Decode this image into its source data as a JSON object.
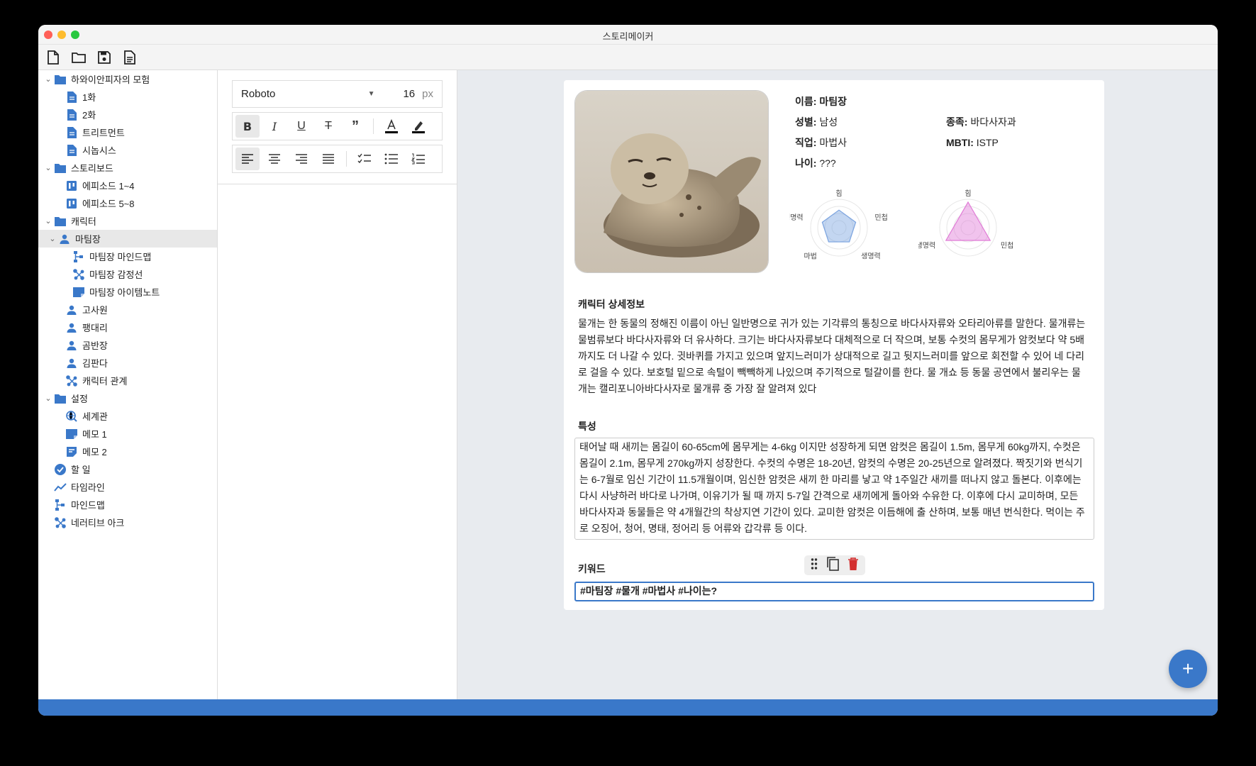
{
  "window": {
    "title": "스토리메이커"
  },
  "toolbar": {
    "icons": [
      "new-file-icon",
      "open-folder-icon",
      "save-icon",
      "document-icon"
    ]
  },
  "sidebar": {
    "items": [
      {
        "label": "하와이안피자의 모험",
        "icon": "folder-icon",
        "level": 0,
        "expandable": true
      },
      {
        "label": "1화",
        "icon": "document-icon",
        "level": 1
      },
      {
        "label": "2화",
        "icon": "document-icon",
        "level": 1
      },
      {
        "label": "트리트먼트",
        "icon": "document-icon",
        "level": 1
      },
      {
        "label": "시놉시스",
        "icon": "document-icon",
        "level": 1
      },
      {
        "label": "스토리보드",
        "icon": "folder-icon",
        "level": 0,
        "expandable": true
      },
      {
        "label": "에피소드 1~4",
        "icon": "board-icon",
        "level": 1
      },
      {
        "label": "에피소드 5~8",
        "icon": "board-icon",
        "level": 1
      },
      {
        "label": "캐릭터",
        "icon": "folder-icon",
        "level": 0,
        "expandable": true
      },
      {
        "label": "마팀장",
        "icon": "person-icon",
        "level": 1,
        "expandable": true,
        "selected": true
      },
      {
        "label": "마팀장 마인드맵",
        "icon": "mindmap-icon",
        "level": 2
      },
      {
        "label": "마팀장 감정선",
        "icon": "graph-icon",
        "level": 2
      },
      {
        "label": "마팀장 아이템노트",
        "icon": "note-icon",
        "level": 2
      },
      {
        "label": "고사원",
        "icon": "person-icon",
        "level": 1
      },
      {
        "label": "팽대리",
        "icon": "person-icon",
        "level": 1
      },
      {
        "label": "곰반장",
        "icon": "person-icon",
        "level": 1
      },
      {
        "label": "김판다",
        "icon": "person-icon",
        "level": 1
      },
      {
        "label": "캐릭터 관계",
        "icon": "graph-icon",
        "level": 1
      },
      {
        "label": "설정",
        "icon": "folder-icon",
        "level": 0,
        "expandable": true
      },
      {
        "label": "세계관",
        "icon": "globe-search-icon",
        "level": 1
      },
      {
        "label": "메모 1",
        "icon": "note-icon",
        "level": 1
      },
      {
        "label": "메모 2",
        "icon": "memo-icon",
        "level": 1
      },
      {
        "label": "할 일",
        "icon": "check-circle-icon",
        "level": 0
      },
      {
        "label": "타임라인",
        "icon": "timeline-icon",
        "level": 0
      },
      {
        "label": "마인드맵",
        "icon": "mindmap-icon",
        "level": 0
      },
      {
        "label": "네러티브 아크",
        "icon": "graph-icon",
        "level": 0
      }
    ]
  },
  "editor": {
    "font": "Roboto",
    "font_size": "16",
    "unit": "px",
    "text_buttons": [
      "bold",
      "italic",
      "underline",
      "strikethrough",
      "quote",
      "text-color",
      "highlight"
    ],
    "paragraph_buttons": [
      "align-left",
      "align-center",
      "align-right",
      "align-justify",
      "checklist",
      "bullet-list",
      "numbered-list"
    ]
  },
  "character": {
    "name_label": "이름:",
    "name": "마팀장",
    "gender_label": "성별:",
    "gender": "남성",
    "species_label": "종족:",
    "species": "바다사자과",
    "job_label": "직업:",
    "job": "마법사",
    "mbti_label": "MBTI:",
    "mbti": "ISTP",
    "age_label": "나이:",
    "age": "???",
    "radar1": {
      "labels": [
        "힘",
        "민첩",
        "생명력",
        "마법",
        "생명력"
      ],
      "values": [
        0.62,
        0.62,
        0.62,
        0.62,
        0.62
      ],
      "color": "#7aa3e0"
    },
    "radar2": {
      "labels": [
        "힘",
        "민첩",
        "생명력"
      ],
      "values": [
        0.9,
        0.9,
        0.9
      ],
      "color": "#e07ad6"
    },
    "detail_title": "캐릭터 상세정보",
    "detail_text": "물개는 한 동물의 정해진 이름이 아닌 일반명으로 귀가 있는 기각류의 통칭으로 바다사자류와 오타리아류를 말한다. 물개류는 물범류보다 바다사자류와 더 유사하다. 크기는 바다사자류보다 대체적으로 더 작으며, 보통 수컷의 몸무게가 암컷보다 약 5배까지도 더 나갈 수 있다. 귓바퀴를 가지고 있으며 앞지느러미가 상대적으로 길고 뒷지느러미를 앞으로 회전할 수 있어 네 다리로 걸을 수 있다. 보호털 밑으로 속털이 빽빽하게 나있으며 주기적으로 털갈이를 한다. 물 개쇼 등 동물 공연에서 불리우는 물개는 캘리포니아바다사자로 물개류 중 가장 잘 알려져 있다",
    "traits_title": "특성",
    "traits_text": "태어날 때 새끼는 몸길이 60-65cm에 몸무게는 4-6kg 이지만 성장하게 되면 암컷은 몸길이 1.5m, 몸무게 60kg까지, 수컷은 몸길이 2.1m, 몸무게 270kg까지 성장한다. 수컷의 수명은 18-20년, 암컷의 수명은 20-25년으로 알려졌다. 짝짓기와 번식기는 6-7월로 임신 기간이 11.5개월이며, 임신한 암컷은 새끼 한 마리를 낳고 약 1주일간 새끼를 떠나지 않고 돌본다. 이후에는 다시 사냥하러 바다로 나가며, 이유기가 될 때 까지 5-7일 간격으로 새끼에게 돌아와 수유한 다. 이후에 다시 교미하며, 모든 바다사자과 동물들은 약 4개월간의 착상지연 기간이 있다. 교미한 암컷은 이듬해에 출 산하며, 보통 매년 번식한다. 먹이는 주로 오징어, 청어, 명태, 정어리 등 어류와 갑각류 등 이다.",
    "keywords_title": "키워드",
    "keywords": "#마팀장 #물개 #마법사 #나이는?"
  },
  "colors": {
    "accent": "#3a78c9",
    "delete": "#d32f2f"
  },
  "fab": {
    "label": "+"
  }
}
